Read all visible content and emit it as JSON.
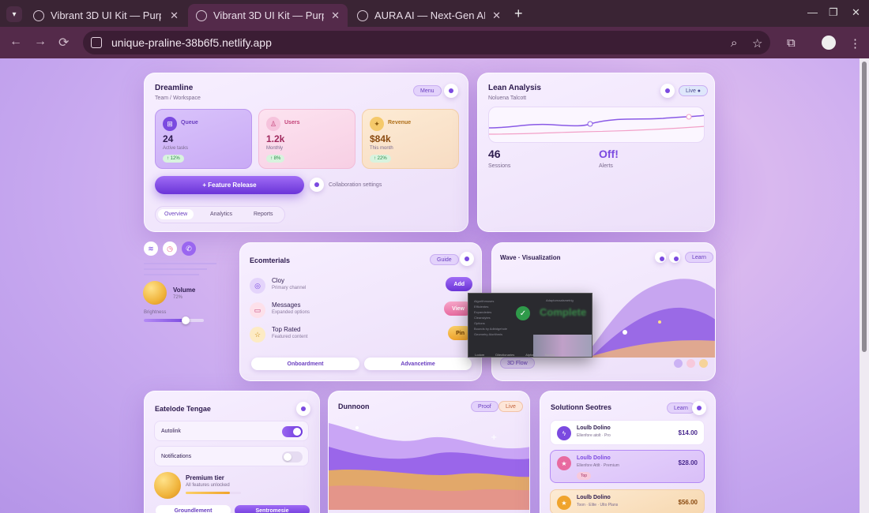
{
  "browser": {
    "tabs": [
      {
        "title": "Vibrant 3D UI Kit — Purpl"
      },
      {
        "title": "Vibrant 3D UI Kit — Purpl"
      },
      {
        "title": "AURA AI — Next-Gen AI C"
      }
    ],
    "url": "unique-praline-38b6f5.netlify.app",
    "icons": {
      "back": "←",
      "forward": "→",
      "reload": "⟳",
      "zoom": "⌕",
      "star": "☆",
      "ext": "⧉",
      "menu": "⋮",
      "close": "✕",
      "new": "+",
      "min": "—",
      "max": "❐",
      "winclose": "✕",
      "tabmenu": "▾"
    }
  },
  "dreamline": {
    "title": "Dreamline",
    "subtitle": "Team / Workspace",
    "menu_label": "Menu",
    "more": "⋮",
    "stats": [
      {
        "label": "Queue",
        "value": "24",
        "sub": "Active tasks",
        "change": "↑ 12%",
        "icon": "⊞"
      },
      {
        "label": "Users",
        "value": "1.2k",
        "sub": "Monthly",
        "change": "↑ 8%",
        "icon": "♙"
      },
      {
        "label": "Revenue",
        "value": "$84k",
        "sub": "This month",
        "change": "↑ 22%",
        "icon": "✦"
      }
    ],
    "cta": "+ Feature Release",
    "settings_link": "Collaboration settings",
    "tabs": [
      "Overview",
      "Analytics",
      "Reports"
    ]
  },
  "lean": {
    "title": "Lean Analysis",
    "subtitle": "Noluena Talcott",
    "live_label": "Live ●",
    "metric1_value": "46",
    "metric1_label": "Sessions",
    "metric2_value": "Off!",
    "metric2_label": "Alerts"
  },
  "side": {
    "icons": [
      "layers-icon",
      "clock-icon",
      "phone-icon"
    ],
    "volume_label": "Volume",
    "volume_value": "72%",
    "brightness_label": "Brightness",
    "brightness_level": 0.7
  },
  "ecom": {
    "title": "Ecomterials",
    "guide_label": "Guide",
    "rows": [
      {
        "title": "Cloy",
        "sub": "Primary channel",
        "btn": "Add",
        "icon": "◎"
      },
      {
        "title": "Messages",
        "sub": "Expanded options",
        "btn": "View",
        "icon": "▭"
      },
      {
        "title": "Top Rated",
        "sub": "Featured content",
        "btn": "Pin",
        "icon": "☆"
      }
    ],
    "btn1": "Onboardment",
    "btn2": "Advancetime"
  },
  "wave": {
    "title": "Wave · Visualization",
    "learn_label": "Learn",
    "flow_label": "3D Flow"
  },
  "settings": {
    "title": "Eatelode Tengae",
    "rows": [
      {
        "label": "Autolink",
        "on": true
      },
      {
        "label": "Notifications",
        "on": false
      }
    ],
    "tier_title": "Premium tier",
    "tier_sub": "All features unlocked",
    "btn1": "Groundlement",
    "btn2": "Sentromesie"
  },
  "dunnoon": {
    "title": "Dunnoon",
    "proof_label": "Proof",
    "live_label": "Live"
  },
  "solutions": {
    "title": "Solutionn Seotres",
    "learn_label": "Learn",
    "items": [
      {
        "name": "Loulb Dolino",
        "sub": "Ellenfore atolt · Pro",
        "price": "$14.00",
        "badge": ""
      },
      {
        "name": "Loulb Dolino",
        "sub": "Ellenfore Attlt · Premium",
        "price": "$28.00",
        "badge": "Top"
      },
      {
        "name": "Loulb Dolino",
        "sub": "Toon · Elite · Ulto Plans",
        "price": "$56.00",
        "badge": ""
      }
    ]
  },
  "overlay": {
    "lines": [
      "Algorithmuses",
      "Efficientes",
      "Expandedes",
      "Cleanslytes",
      "Options",
      "Bounds by Adbidgehole",
      "Geometry Alorithmis"
    ],
    "right_title": "Adaptornaalsmetrig",
    "big_text": "Complete",
    "footer": [
      "Lodom",
      "Dilectionaries",
      "Alpha",
      "Sooner"
    ]
  },
  "colors": {
    "accent": "#7b4ae0",
    "pink": "#e86aa0",
    "gold": "#f0b43c"
  }
}
